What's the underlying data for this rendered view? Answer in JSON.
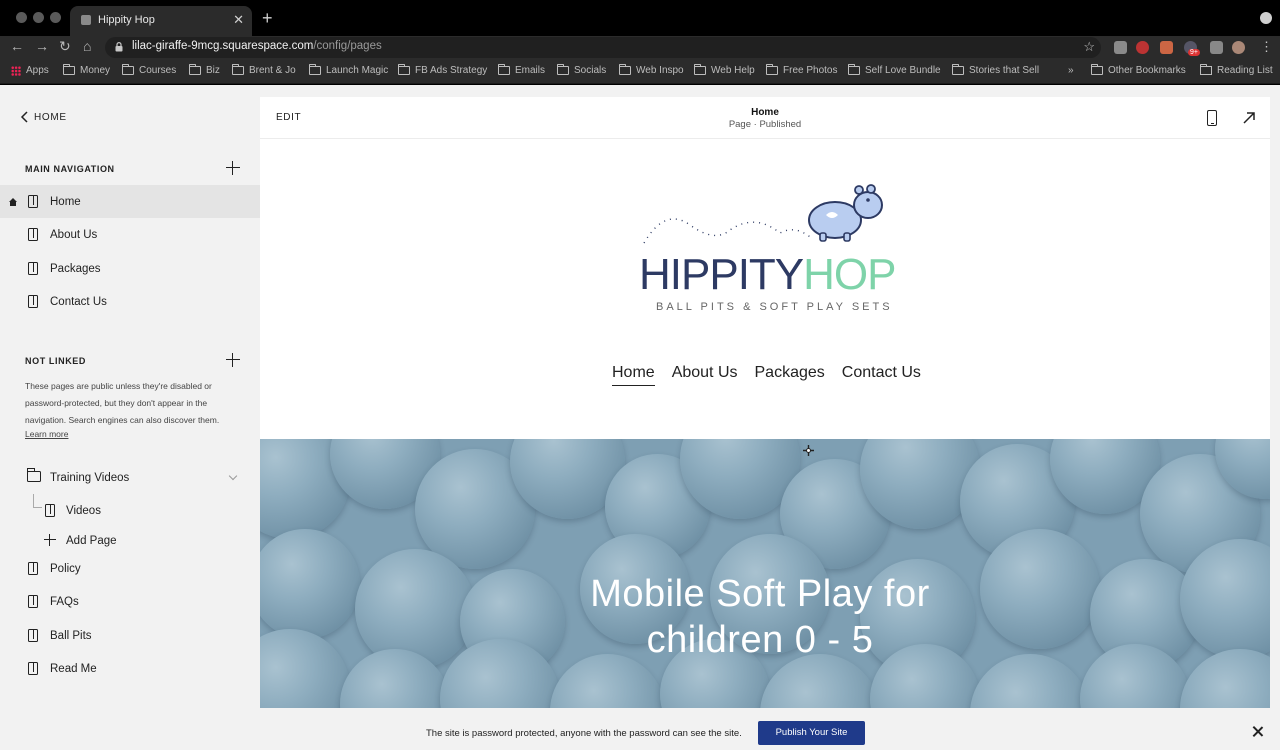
{
  "browser": {
    "tab_title": "Hippity Hop",
    "new_tab": "+",
    "url_host": "lilac-giraffe-9mcg.squarespace.com",
    "url_path": "/config/pages",
    "bookmarks": [
      "Apps",
      "Money",
      "Courses",
      "Biz",
      "Brent & Jo",
      "Launch Magic",
      "FB Ads Strategy",
      "Emails",
      "Socials",
      "Web Inspo",
      "Web Help",
      "Free Photos",
      "Self Love Bundle",
      "Stories that Sell"
    ],
    "bookmarks_overflow": "»",
    "other_bookmarks": "Other Bookmarks",
    "reading_list": "Reading List",
    "extension_badge": "9+"
  },
  "sidebar": {
    "back_label": "HOME",
    "main_nav_label": "MAIN NAVIGATION",
    "main_nav": [
      "Home",
      "About Us",
      "Packages",
      "Contact Us"
    ],
    "not_linked_label": "NOT LINKED",
    "not_linked_desc": "These pages are public unless they're disabled or password-protected, but they don't appear in the navigation. Search engines can also discover them.",
    "learn_more": "Learn more",
    "folder": "Training Videos",
    "folder_child": "Videos",
    "add_page": "Add Page",
    "not_linked_pages": [
      "Policy",
      "FAQs",
      "Ball Pits",
      "Read Me"
    ]
  },
  "editor": {
    "edit_label": "EDIT",
    "page_title": "Home",
    "page_status": "Page · Published"
  },
  "site": {
    "logo_part1": "HIPPITY",
    "logo_part2": "HOP",
    "logo_tagline": "BALL PITS & SOFT PLAY SETS",
    "nav": [
      "Home",
      "About Us",
      "Packages",
      "Contact Us"
    ],
    "hero_line1": "Mobile Soft Play for",
    "hero_line2": "children 0 - 5"
  },
  "banner": {
    "text": "The site is password protected, anyone with the password can see the site.",
    "publish_label": "Publish Your Site"
  },
  "colors": {
    "publish_button": "#1f3a8a",
    "logo_navy": "#2d3a63",
    "logo_mint": "#7ed3a9",
    "hero_bg": "#7e9fb3"
  }
}
